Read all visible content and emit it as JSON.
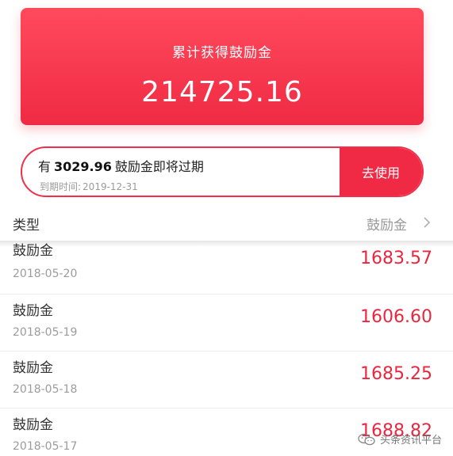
{
  "summary": {
    "label": "累计获得鼓励金",
    "total": "214725.16"
  },
  "expiring": {
    "prefix": "有",
    "amount": "3029.96",
    "suffix": "鼓励金即将过期",
    "due_label": "到期时间:",
    "due_date": "2019-12-31",
    "button_label": "去使用"
  },
  "header": {
    "type_label": "类型",
    "amount_label": "鼓励金"
  },
  "rows": [
    {
      "title": "鼓励金",
      "date": "2018-05-20",
      "amount": "1683.57"
    },
    {
      "title": "鼓励金",
      "date": "2018-05-19",
      "amount": "1606.60"
    },
    {
      "title": "鼓励金",
      "date": "2018-05-18",
      "amount": "1685.25"
    },
    {
      "title": "鼓励金",
      "date": "2018-05-17",
      "amount": "1688.82"
    }
  ],
  "watermark": {
    "text": "头条资讯平台",
    "icon": "wechat-icon"
  },
  "colors": {
    "accent": "#f02a44",
    "amount": "#e8273f"
  }
}
